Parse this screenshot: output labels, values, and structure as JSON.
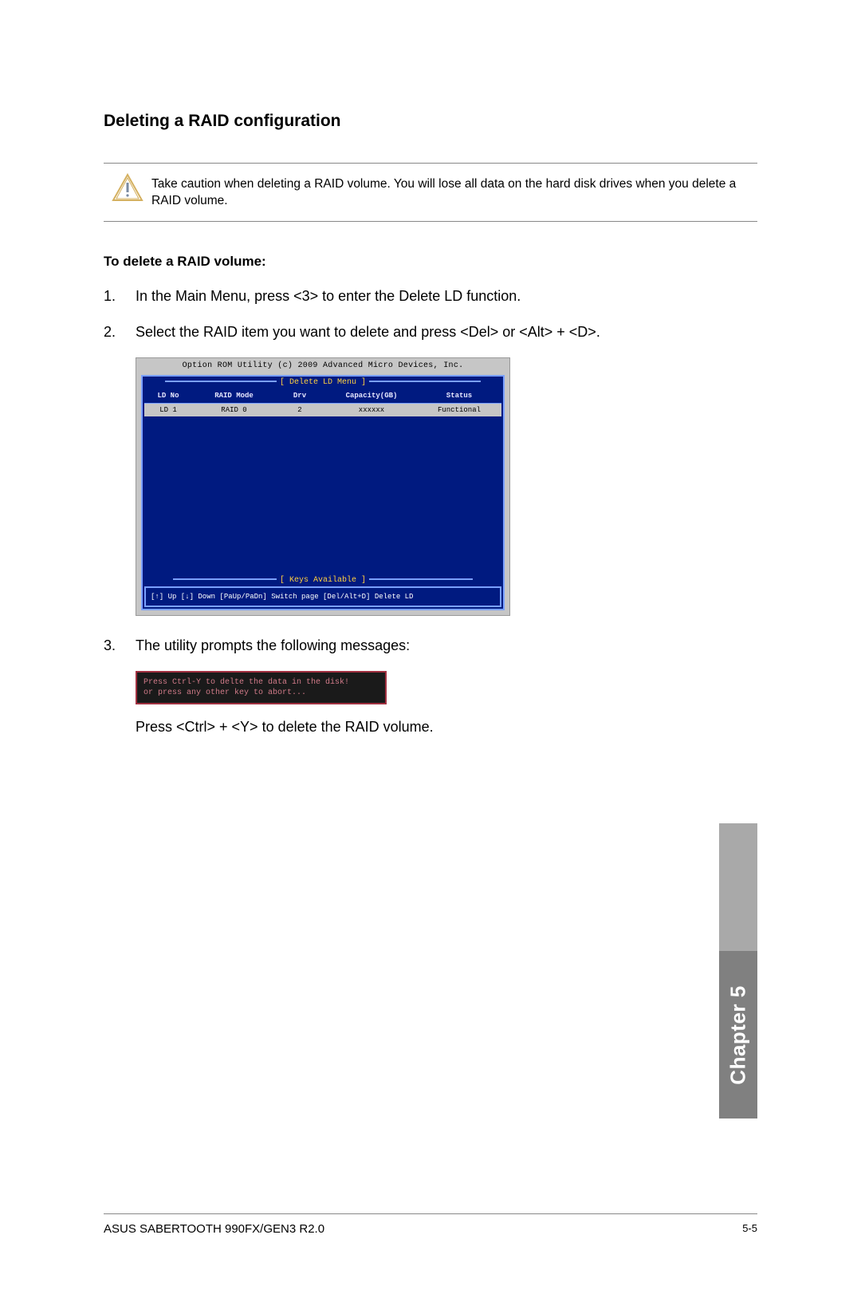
{
  "section_title": "Deleting a RAID configuration",
  "caution": {
    "text": "Take caution when deleting a RAID volume. You will lose all data on the hard disk drives when you delete a RAID volume."
  },
  "subtitle": "To delete a RAID volume:",
  "steps": {
    "one": {
      "n": "1.",
      "t": "In the Main Menu, press <3> to enter the Delete LD function."
    },
    "two": {
      "n": "2.",
      "t": "Select the RAID item you want to delete and press <Del> or <Alt> + <D>."
    },
    "three": {
      "n": "3.",
      "t": "The utility prompts the following messages:"
    }
  },
  "bios": {
    "title": "Option ROM Utility (c) 2009 Advanced Micro Devices, Inc.",
    "menu_label": "[ Delete LD Menu ]",
    "headers": {
      "c1": "LD No",
      "c2": "RAID Mode",
      "c3": "Drv",
      "c4": "Capacity(GB)",
      "c5": "Status"
    },
    "row": {
      "c1": "LD  1",
      "c2": "RAID 0",
      "c3": "2",
      "c4": "xxxxxx",
      "c5": "Functional"
    },
    "keys_label": "[ Keys Available ]",
    "keys": "[↑] Up  [↓] Down  [PaUp/PaDn] Switch page  [Del/Alt+D] Delete LD"
  },
  "prompt": {
    "l1": "Press Ctrl-Y to delte the data in the disk!",
    "l2": "or press any other key to abort..."
  },
  "after3": "Press <Ctrl> + <Y> to delete the RAID volume.",
  "chapter_tab": "Chapter 5",
  "footer": {
    "left": "ASUS SABERTOOTH 990FX/GEN3 R2.0",
    "right": "5-5"
  }
}
